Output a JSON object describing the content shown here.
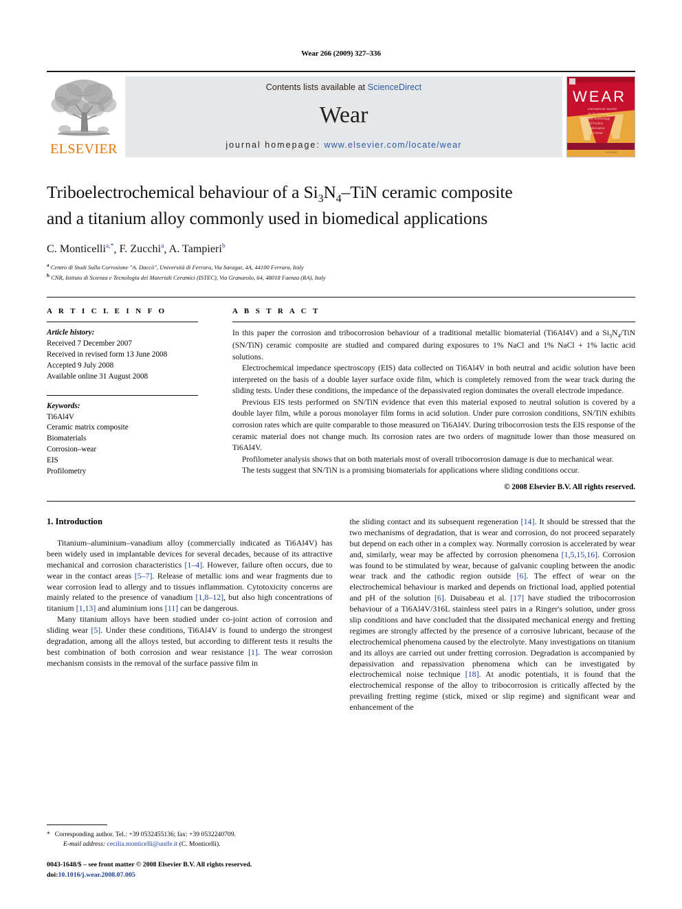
{
  "running_head": "Wear 266 (2009) 327–336",
  "masthead": {
    "publisher_name": "ELSEVIER",
    "contents_prefix": "Contents lists available at ",
    "contents_link": "ScienceDirect",
    "journal_name": "Wear",
    "homepage_prefix": "journal homepage: ",
    "homepage_url": "www.elsevier.com/locate/wear",
    "cover_title": "WEAR",
    "cover_subtitle": "International Journal on the Science and Technology of Friction Lubrication and Wear",
    "colors": {
      "link": "#2b57a6",
      "elsevier_orange": "#ec7404",
      "panel_gray": "#e6e7e8",
      "cover_red": "#c8102e",
      "cover_gold": "#e8a33d"
    }
  },
  "article": {
    "title_line1": "Triboelectrochemical behaviour of a Si3N4–TiN ceramic composite",
    "title_line2": "and a titanium alloy commonly used in biomedical applications",
    "authors": [
      {
        "name": "C. Monticelli",
        "marks": "a,*"
      },
      {
        "name": "F. Zucchi",
        "marks": "a"
      },
      {
        "name": "A. Tampieri",
        "marks": "b"
      }
    ],
    "affiliations": [
      {
        "mark": "a",
        "text": "Centro di Studi Sulla Corrosione \"A. Daccò\", Università di Ferrara, Via Saragat, 4A, 44100 Ferrara, Italy"
      },
      {
        "mark": "b",
        "text": "CNR, Istituto di Scienza e Tecnologia dei Materiali Ceramici (ISTEC), Via Granarolo, 64, 48018 Faenza (RA), Italy"
      }
    ]
  },
  "article_info": {
    "label": "A R T I C L E    I N F O",
    "history_heading": "Article history:",
    "history": [
      "Received 7 December 2007",
      "Received in revised form 13 June 2008",
      "Accepted 9 July 2008",
      "Available online 31 August 2008"
    ],
    "keywords_heading": "Keywords:",
    "keywords": [
      "Ti6Al4V",
      "Ceramic matrix composite",
      "Biomaterials",
      "Corrosion–wear",
      "EIS",
      "Profilometry"
    ]
  },
  "abstract": {
    "label": "A B S T R A C T",
    "paragraphs": [
      "In this paper the corrosion and tribocorrosion behaviour of a traditional metallic biomaterial (Ti6Al4V) and a Si3N4/TiN (SN/TiN) ceramic composite are studied and compared during exposures to 1% NaCl and 1% NaCl + 1% lactic acid solutions.",
      "Electrochemical impedance spectroscopy (EIS) data collected on Ti6Al4V in both neutral and acidic solution have been interpreted on the basis of a double layer surface oxide film, which is completely removed from the wear track during the sliding tests. Under these conditions, the impedance of the depassivated region dominates the overall electrode impedance.",
      "Previous EIS tests performed on SN/TiN evidence that even this material exposed to neutral solution is covered by a double layer film, while a porous monolayer film forms in acid solution. Under pure corrosion conditions, SN/TiN exhibits corrosion rates which are quite comparable to those measured on Ti6Al4V. During tribocorrosion tests the EIS response of the ceramic material does not change much. Its corrosion rates are two orders of magnitude lower than those measured on Ti6Al4V.",
      "Profilometer analysis shows that on both materials most of overall tribocorrosion damage is due to mechanical wear.",
      "The tests suggest that SN/TiN is a promising biomaterials for applications where sliding conditions occur."
    ],
    "copyright": "© 2008 Elsevier B.V. All rights reserved."
  },
  "introduction": {
    "heading": "1. Introduction",
    "left_paragraphs": [
      "Titanium–aluminium–vanadium alloy (commercially indicated as Ti6Al4V) has been widely used in implantable devices for several decades, because of its attractive mechanical and corrosion characteristics [1–4]. However, failure often occurs, due to wear in the contact areas [5–7]. Release of metallic ions and wear fragments due to wear corrosion lead to allergy and to tissues inflammation. Cytotoxicity concerns are mainly related to the presence of vanadium [1,8–12], but also high concentrations of titanium [1,13] and aluminium ions [11] can be dangerous.",
      "Many titanium alloys have been studied under co-joint action of corrosion and sliding wear [5]. Under these conditions, Ti6Al4V is found to undergo the strongest degradation, among all the alloys tested, but according to different tests it results the best combination of both corrosion and wear resistance [1]. The wear corrosion mechanism consists in the removal of the surface passive film in"
    ],
    "right_paragraphs": [
      "the sliding contact and its subsequent regeneration [14]. It should be stressed that the two mechanisms of degradation, that is wear and corrosion, do not proceed separately but depend on each other in a complex way. Normally corrosion is accelerated by wear and, similarly, wear may be affected by corrosion phenomena [1,5,15,16]. Corrosion was found to be stimulated by wear, because of galvanic coupling between the anodic wear track and the cathodic region outside [6]. The effect of wear on the electrochemical behaviour is marked and depends on frictional load, applied potential and pH of the solution [6]. Duisabeau et al. [17] have studied the tribocorrosion behaviour of a Ti6Al4V/316L stainless steel pairs in a Ringer's solution, under gross slip conditions and have concluded that the dissipated mechanical energy and fretting regimes are strongly affected by the presence of a corrosive lubricant, because of the electrochemical phenomena caused by the electrolyte. Many investigations on titanium and its alloys are carried out under fretting corrosion. Degradation is accompanied by depassivation and repassivation phenomena which can be investigated by electrochemical noise technique [18]. At anodic potentials, it is found that the electrochemical response of the alloy to tribocorrosion is critically affected by the prevailing fretting regime (stick, mixed or slip regime) and significant wear and enhancement of the"
    ]
  },
  "footnote": {
    "corresponding": "Corresponding author. Tel.: +39 0532455136; fax: +39 0532240709.",
    "email_label": "E-mail address:",
    "email": "cecilia.monticelli@unife.it",
    "email_suffix": " (C. Monticelli).",
    "imprint": "0043-1648/$ – see front matter © 2008 Elsevier B.V. All rights reserved.",
    "doi_label": "doi:",
    "doi": "10.1016/j.wear.2008.07.005"
  }
}
